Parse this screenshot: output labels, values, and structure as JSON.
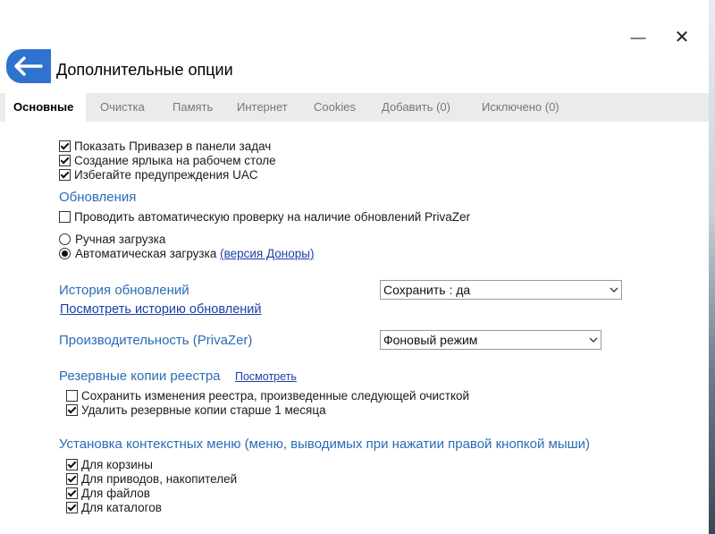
{
  "window": {
    "minimize_icon": "—",
    "close_icon": "✕"
  },
  "header": {
    "back_icon": "arrow-left",
    "title": "Дополнительные опции"
  },
  "tabs": [
    "Основные",
    "Очистка",
    "Память",
    "Интернет",
    "Cookies",
    "Добавить (0)",
    "Исключено (0)"
  ],
  "general": {
    "show_taskbar": {
      "label": "Показать Привазер в панели задач",
      "checked": true
    },
    "desktop_shortcut": {
      "label": "Создание ярлыка на рабочем столе",
      "checked": true
    },
    "avoid_uac": {
      "label": "Избегайте предупреждения UAC",
      "checked": true
    }
  },
  "updates": {
    "section_title": "Обновления",
    "auto_check": {
      "label": "Проводить автоматическую проверку на наличие обновлений PrivaZer",
      "checked": false
    },
    "manual_download": {
      "label": "Ручная загрузка",
      "selected": false
    },
    "auto_download": {
      "label": "Автоматическая загрузка",
      "selected": true,
      "link": "(версия Доноры)"
    }
  },
  "history": {
    "label": "История обновлений",
    "select_value": "Сохранить : да",
    "view_link": "Посмотреть историю обновлений"
  },
  "performance": {
    "label": "Производительность (PrivaZer)",
    "select_value": "Фоновый режим"
  },
  "registry": {
    "section_title": "Резервные копии реестра",
    "view_link": "Посмотреть",
    "save_changes": {
      "label": "Сохранить изменения реестра, произведенные следующей очисткой",
      "checked": false
    },
    "delete_old": {
      "label": "Удалить резервные копии старше 1 месяца",
      "checked": true
    }
  },
  "context_menu": {
    "section_title": "Установка контекстных меню (меню, выводимых при нажатии правой кнопкой мыши)",
    "recycle_bin": {
      "label": "Для корзины",
      "checked": true
    },
    "drives": {
      "label": "Для приводов, накопителей",
      "checked": true
    },
    "files": {
      "label": "Для файлов",
      "checked": true
    },
    "folders": {
      "label": "Для каталогов",
      "checked": true
    }
  }
}
